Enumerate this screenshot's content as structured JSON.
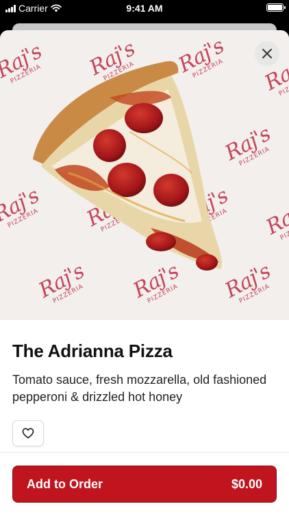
{
  "status_bar": {
    "carrier": "Carrier",
    "time": "9:41 AM"
  },
  "hero": {
    "logo_text": "Raj's",
    "logo_subtext": "PIZZERIA"
  },
  "item": {
    "title": "The Adrianna Pizza",
    "description": "Tomato sauce, fresh mozzarella, old fashioned pepperoni & drizzled hot honey"
  },
  "actions": {
    "add_label": "Add to Order",
    "price": "$0.00"
  },
  "icons": {
    "close": "close-icon",
    "favorite": "heart-icon"
  },
  "colors": {
    "accent": "#c0141f",
    "logo": "#c3455a"
  }
}
